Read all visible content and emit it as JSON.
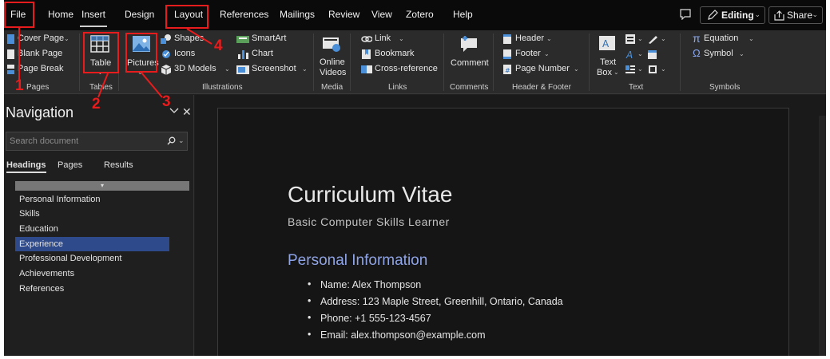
{
  "menubar": {
    "tabs": [
      "File",
      "Home",
      "Insert",
      "Design",
      "Layout",
      "References",
      "Mailings",
      "Review",
      "View",
      "Zotero",
      "Help"
    ],
    "active_tab": "Insert",
    "editing_label": "Editing",
    "share_label": "Share"
  },
  "ribbon": {
    "pages": {
      "cover_page": "Cover Page",
      "blank_page": "Blank Page",
      "page_break": "Page Break",
      "group": "Pages"
    },
    "tables": {
      "table": "Table",
      "group": "Tables"
    },
    "illustrations": {
      "pictures": "Pictures",
      "shapes": "Shapes",
      "icons": "Icons",
      "models": "3D Models",
      "smartart": "SmartArt",
      "chart": "Chart",
      "screenshot": "Screenshot",
      "group": "Illustrations"
    },
    "media": {
      "online_videos_1": "Online",
      "online_videos_2": "Videos",
      "group": "Media"
    },
    "links": {
      "link": "Link",
      "bookmark": "Bookmark",
      "cross_reference": "Cross-reference",
      "group": "Links"
    },
    "comments": {
      "comment": "Comment",
      "group": "Comments"
    },
    "header_footer": {
      "header": "Header",
      "footer": "Footer",
      "page_number": "Page Number",
      "group": "Header & Footer"
    },
    "text": {
      "text_box_1": "Text",
      "text_box_2": "Box",
      "group": "Text"
    },
    "symbols": {
      "equation": "Equation",
      "symbol": "Symbol",
      "group": "Symbols"
    }
  },
  "navigation": {
    "title": "Navigation",
    "search_placeholder": "Search document",
    "tabs": [
      "Headings",
      "Pages",
      "Results"
    ],
    "active_tab": "Headings",
    "headings": [
      "Personal Information",
      "Skills",
      "Education",
      "Experience",
      "Professional Development",
      "Achievements",
      "References"
    ],
    "selected_heading": "Experience"
  },
  "document": {
    "title": "Curriculum Vitae",
    "subtitle": "Basic Computer Skills Learner",
    "section_heading": "Personal Information",
    "items": [
      "Name: Alex Thompson",
      "Address: 123 Maple Street, Greenhill, Ontario, Canada",
      "Phone: +1 555-123-4567",
      "Email: alex.thompson@example.com"
    ]
  },
  "annotations": [
    "1",
    "2",
    "3",
    "4"
  ],
  "colors": {
    "annotation": "#e81c1c",
    "selected_heading": "#2e4a8a",
    "section_heading": "#8fa4e6"
  }
}
